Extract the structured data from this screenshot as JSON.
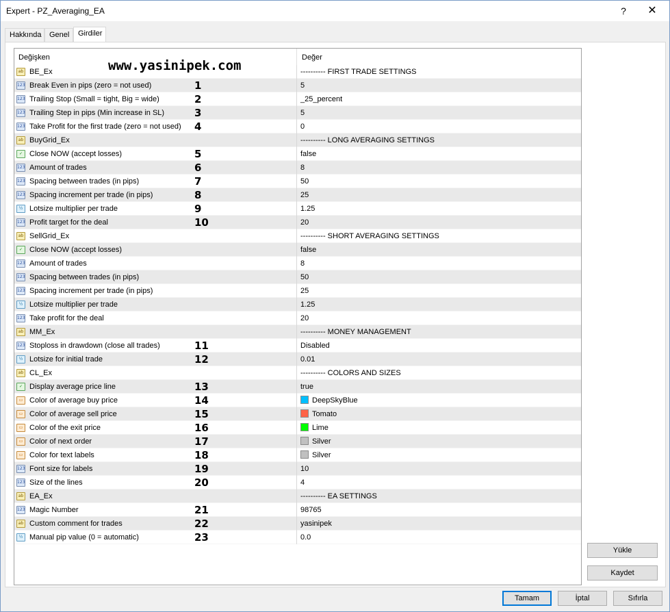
{
  "window": {
    "title": "Expert - PZ_Averaging_EA",
    "help_label": "?",
    "close_label": "✕"
  },
  "tabs": [
    {
      "label": "Hakkında"
    },
    {
      "label": "Genel"
    },
    {
      "label": "Girdiler",
      "active": true
    }
  ],
  "table": {
    "headers": {
      "name": "Değişken",
      "value": "Değer"
    },
    "rows": [
      {
        "type": "str",
        "icon": "ab",
        "name": "BE_Ex",
        "value": "---------- FIRST TRADE SETTINGS",
        "badge": ""
      },
      {
        "type": "num",
        "icon": "123",
        "name": "Break Even in pips (zero = not used)",
        "value": "5",
        "badge": "1"
      },
      {
        "type": "num",
        "icon": "123",
        "name": "Trailing Stop (Small = tight, Big = wide)",
        "value": "_25_percent",
        "badge": "2"
      },
      {
        "type": "num",
        "icon": "123",
        "name": "Trailing Step in pips (Min increase in SL)",
        "value": "5",
        "badge": "3"
      },
      {
        "type": "num",
        "icon": "123",
        "name": "Take Profit for the first trade (zero = not used)",
        "value": "0",
        "badge": "4"
      },
      {
        "type": "str",
        "icon": "ab",
        "name": "BuyGrid_Ex",
        "value": "---------- LONG AVERAGING SETTINGS",
        "badge": ""
      },
      {
        "type": "bool",
        "icon": "✓",
        "name": "Close NOW (accept losses)",
        "value": "false",
        "badge": "5"
      },
      {
        "type": "num",
        "icon": "123",
        "name": "Amount of trades",
        "value": "8",
        "badge": "6"
      },
      {
        "type": "num",
        "icon": "123",
        "name": "Spacing between trades (in pips)",
        "value": "50",
        "badge": "7"
      },
      {
        "type": "num",
        "icon": "123",
        "name": "Spacing increment per trade (in pips)",
        "value": "25",
        "badge": "8"
      },
      {
        "type": "dbl",
        "icon": "½",
        "name": "Lotsize multiplier per trade",
        "value": "1.25",
        "badge": "9"
      },
      {
        "type": "num",
        "icon": "123",
        "name": "Profit target for the deal",
        "value": "20",
        "badge": "10"
      },
      {
        "type": "str",
        "icon": "ab",
        "name": "SellGrid_Ex",
        "value": "---------- SHORT AVERAGING SETTINGS",
        "badge": ""
      },
      {
        "type": "bool",
        "icon": "✓",
        "name": "Close NOW (accept losses)",
        "value": "false",
        "badge": ""
      },
      {
        "type": "num",
        "icon": "123",
        "name": "Amount of trades",
        "value": "8",
        "badge": ""
      },
      {
        "type": "num",
        "icon": "123",
        "name": "Spacing between trades (in pips)",
        "value": "50",
        "badge": ""
      },
      {
        "type": "num",
        "icon": "123",
        "name": "Spacing increment per trade (in pips)",
        "value": "25",
        "badge": ""
      },
      {
        "type": "dbl",
        "icon": "½",
        "name": "Lotsize multiplier per trade",
        "value": "1.25",
        "badge": ""
      },
      {
        "type": "num",
        "icon": "123",
        "name": "Take profit for the deal",
        "value": "20",
        "badge": ""
      },
      {
        "type": "str",
        "icon": "ab",
        "name": "MM_Ex",
        "value": "---------- MONEY MANAGEMENT",
        "badge": ""
      },
      {
        "type": "num",
        "icon": "123",
        "name": "Stoploss in drawdown (close all trades)",
        "value": "Disabled",
        "badge": "11"
      },
      {
        "type": "dbl",
        "icon": "½",
        "name": "Lotsize for initial trade",
        "value": "0.01",
        "badge": "12"
      },
      {
        "type": "str",
        "icon": "ab",
        "name": "CL_Ex",
        "value": "---------- COLORS AND SIZES",
        "badge": ""
      },
      {
        "type": "bool",
        "icon": "✓",
        "name": "Display average price line",
        "value": "true",
        "badge": "13"
      },
      {
        "type": "col",
        "icon": "▭",
        "name": "Color of average buy price",
        "value": "DeepSkyBlue",
        "swatch": "#00bfff",
        "badge": "14"
      },
      {
        "type": "col",
        "icon": "▭",
        "name": "Color of average sell price",
        "value": "Tomato",
        "swatch": "#ff6347",
        "badge": "15"
      },
      {
        "type": "col",
        "icon": "▭",
        "name": "Color of the exit price",
        "value": "Lime",
        "swatch": "#00ff00",
        "badge": "16"
      },
      {
        "type": "col",
        "icon": "▭",
        "name": "Color of next order",
        "value": "Silver",
        "swatch": "#c0c0c0",
        "badge": "17"
      },
      {
        "type": "col",
        "icon": "▭",
        "name": "Color for text labels",
        "value": "Silver",
        "swatch": "#c0c0c0",
        "badge": "18"
      },
      {
        "type": "num",
        "icon": "123",
        "name": "Font size for labels",
        "value": "10",
        "badge": "19"
      },
      {
        "type": "num",
        "icon": "123",
        "name": "Size of the lines",
        "value": "4",
        "badge": "20"
      },
      {
        "type": "str",
        "icon": "ab",
        "name": "EA_Ex",
        "value": "---------- EA SETTINGS",
        "badge": ""
      },
      {
        "type": "num",
        "icon": "123",
        "name": "Magic Number",
        "value": "98765",
        "badge": "21"
      },
      {
        "type": "str",
        "icon": "ab",
        "name": "Custom comment for trades",
        "value": "yasinipek",
        "badge": "22"
      },
      {
        "type": "dbl",
        "icon": "½",
        "name": "Manual pip value (0 = automatic)",
        "value": "0.0",
        "badge": "23"
      }
    ]
  },
  "watermark": "www.yasinipek.com",
  "side_buttons": {
    "load": "Yükle",
    "save": "Kaydet"
  },
  "footer_buttons": {
    "ok": "Tamam",
    "cancel": "İptal",
    "reset": "Sıfırla"
  }
}
